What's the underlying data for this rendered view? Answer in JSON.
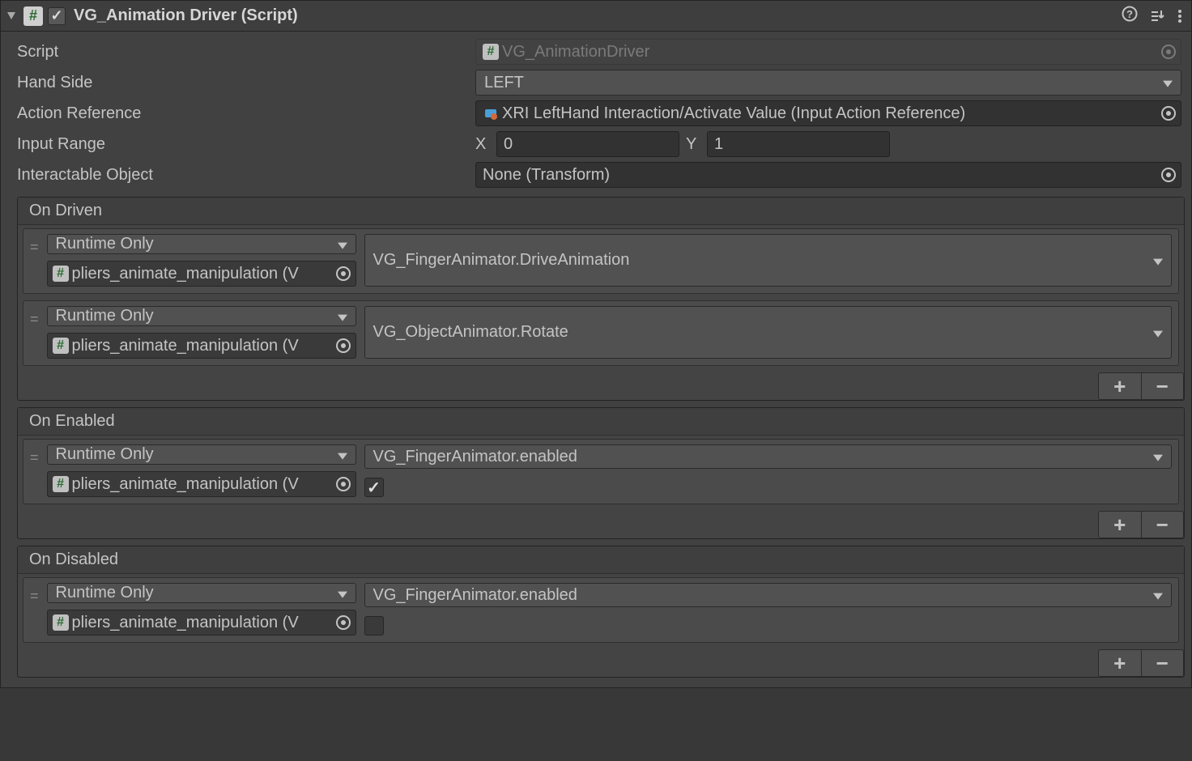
{
  "header": {
    "title": "VG_Animation Driver (Script)",
    "enabled": true
  },
  "fields": {
    "script": {
      "label": "Script",
      "value": "VG_AnimationDriver"
    },
    "handSide": {
      "label": "Hand Side",
      "value": "LEFT"
    },
    "actionRef": {
      "label": "Action Reference",
      "value": "XRI LeftHand Interaction/Activate Value (Input Action Reference)"
    },
    "inputRange": {
      "label": "Input Range",
      "x": "0",
      "y": "1"
    },
    "interactableObject": {
      "label": "Interactable Object",
      "value": "None (Transform)"
    }
  },
  "events": {
    "onDriven": {
      "title": "On Driven",
      "items": [
        {
          "runtime": "Runtime Only",
          "method": "VG_FingerAnimator.DriveAnimation",
          "target": "pliers_animate_manipulation (V"
        },
        {
          "runtime": "Runtime Only",
          "method": "VG_ObjectAnimator.Rotate",
          "target": "pliers_animate_manipulation (V"
        }
      ]
    },
    "onEnabled": {
      "title": "On Enabled",
      "items": [
        {
          "runtime": "Runtime Only",
          "method": "VG_FingerAnimator.enabled",
          "target": "pliers_animate_manipulation (V",
          "boolArg": true
        }
      ]
    },
    "onDisabled": {
      "title": "On Disabled",
      "items": [
        {
          "runtime": "Runtime Only",
          "method": "VG_FingerAnimator.enabled",
          "target": "pliers_animate_manipulation (V",
          "boolArg": false
        }
      ]
    }
  }
}
